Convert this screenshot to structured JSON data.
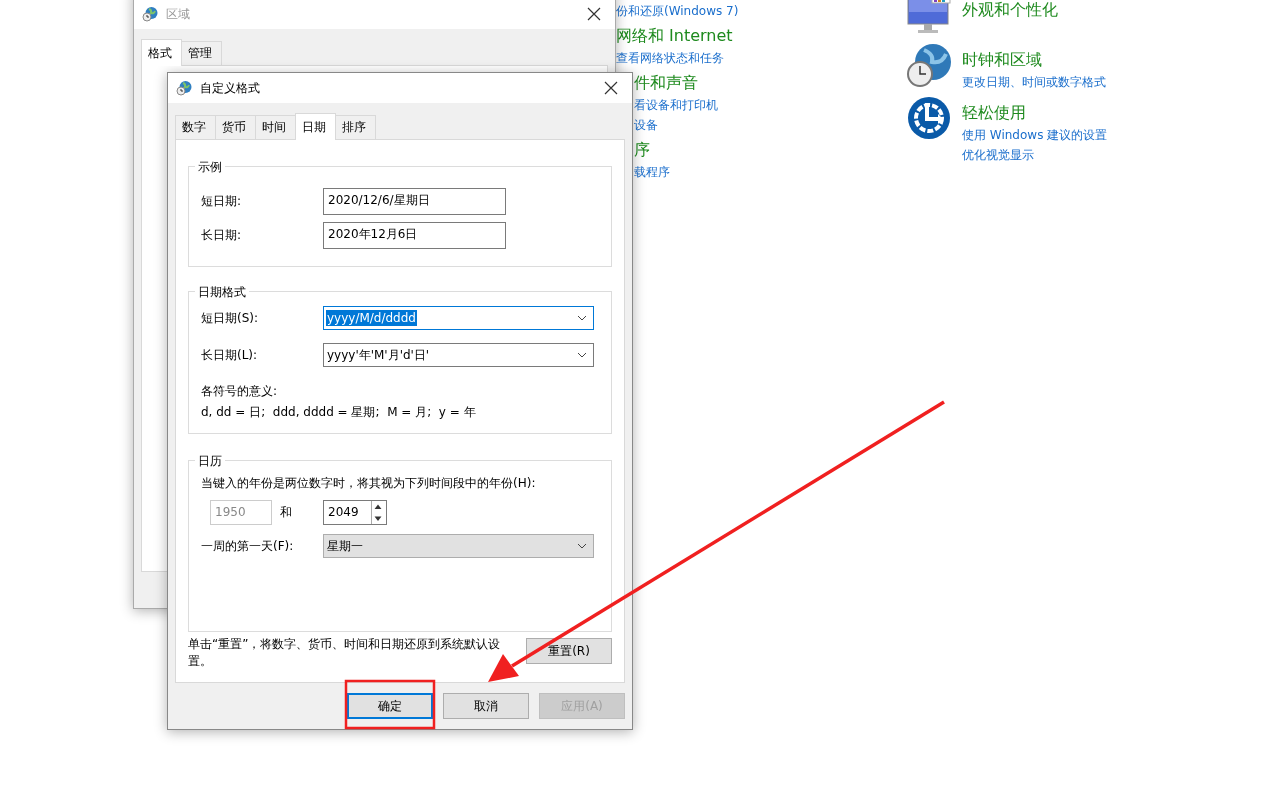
{
  "control_panel": {
    "left_items": [
      {
        "kind": "link",
        "text": "份和还原(Windows 7)"
      },
      {
        "kind": "title",
        "text": "网络和 Internet"
      },
      {
        "kind": "link",
        "text": "查看网络状态和任务"
      },
      {
        "kind": "title",
        "text": "件和声音"
      },
      {
        "kind": "link",
        "text": "看设备和打印机"
      },
      {
        "kind": "link",
        "text": "设备"
      },
      {
        "kind": "title",
        "text": "序"
      },
      {
        "kind": "link",
        "text": "载程序"
      }
    ],
    "categories": [
      {
        "kind": "appearance",
        "title": "外观和个性化"
      },
      {
        "kind": "clock",
        "title": "时钟和区域",
        "links": [
          "更改日期、时间或数字格式"
        ]
      },
      {
        "kind": "access",
        "title": "轻松使用",
        "links": [
          "使用 Windows 建议的设置",
          "优化视觉显示"
        ]
      }
    ]
  },
  "region_window": {
    "title": "区域",
    "tabs": [
      {
        "label": "格式",
        "selected": true
      },
      {
        "label": "管理",
        "selected": false
      }
    ]
  },
  "custom_format_dialog": {
    "title": "自定义格式",
    "tabs": [
      {
        "label": "数字",
        "selected": false
      },
      {
        "label": "货币",
        "selected": false
      },
      {
        "label": "时间",
        "selected": false
      },
      {
        "label": "日期",
        "selected": true
      },
      {
        "label": "排序",
        "selected": false
      }
    ],
    "example": {
      "legend": "示例",
      "rows": [
        {
          "label": "短日期:",
          "value": "2020/12/6/星期日"
        },
        {
          "label": "长日期:",
          "value": "2020年12月6日"
        }
      ]
    },
    "date_formats": {
      "legend": "日期格式",
      "rows": [
        {
          "label": "短日期(S):",
          "value": "yyyy/M/d/dddd",
          "selected": true
        },
        {
          "label": "长日期(L):",
          "value": "yyyy'年'M'月'd'日'",
          "selected": false
        }
      ],
      "notes": [
        "各符号的意义:",
        "d, dd = 日;  ddd, dddd = 星期;  M = 月;  y = 年"
      ]
    },
    "calendar": {
      "legend": "日历",
      "range_label": "当键入的年份是两位数字时，将其视为下列时间段中的年份(H):",
      "from_value": "1950",
      "and_label": "和",
      "to_value": "2049",
      "first_day_label": "一周的第一天(F):",
      "first_day_value": "星期一"
    },
    "reset_note": "单击“重置”，将数字、货币、时间和日期还原到系统默认设置。",
    "reset_button": "重置(R)",
    "buttons": [
      {
        "label": "确定",
        "focused": true,
        "disabled": false
      },
      {
        "label": "取消",
        "focused": false,
        "disabled": false
      },
      {
        "label": "应用(A)",
        "focused": false,
        "disabled": true
      }
    ]
  }
}
